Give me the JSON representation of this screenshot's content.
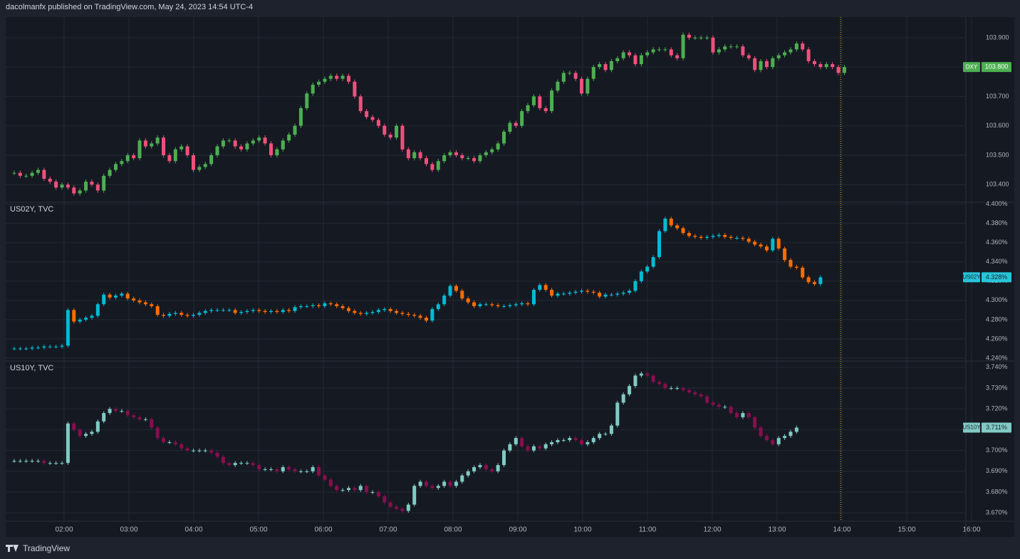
{
  "header": {
    "publisher": "dacolmanfx published on TradingView.com, May 24, 2023 14:54 UTC-4"
  },
  "footer": {
    "brand": "TradingView",
    "logo_icon": "tradingview-logo-icon"
  },
  "chart_data": [
    {
      "type": "candlestick",
      "name": "DXY",
      "title": "",
      "yticks": [
        "103.900",
        "103.800",
        "103.700",
        "103.600",
        "103.500",
        "103.400"
      ],
      "ylim": [
        103.34,
        103.97
      ],
      "last_price": "103.800",
      "price_label_color": "#4caf50",
      "up_color": "#4caf50",
      "down_color": "#f0507c",
      "closes": [
        103.44,
        103.43,
        103.43,
        103.44,
        103.45,
        103.42,
        103.41,
        103.39,
        103.4,
        103.39,
        103.37,
        103.38,
        103.41,
        103.4,
        103.38,
        103.43,
        103.45,
        103.47,
        103.48,
        103.5,
        103.49,
        103.55,
        103.53,
        103.54,
        103.56,
        103.5,
        103.48,
        103.52,
        103.53,
        103.5,
        103.45,
        103.46,
        103.47,
        103.5,
        103.53,
        103.55,
        103.55,
        103.53,
        103.52,
        103.54,
        103.55,
        103.56,
        103.54,
        103.5,
        103.52,
        103.55,
        103.57,
        103.6,
        103.66,
        103.71,
        103.74,
        103.75,
        103.76,
        103.77,
        103.76,
        103.77,
        103.75,
        103.7,
        103.65,
        103.63,
        103.62,
        103.6,
        103.57,
        103.56,
        103.6,
        103.52,
        103.49,
        103.51,
        103.49,
        103.47,
        103.45,
        103.48,
        103.5,
        103.51,
        103.5,
        103.49,
        103.49,
        103.48,
        103.5,
        103.51,
        103.52,
        103.54,
        103.58,
        103.61,
        103.6,
        103.65,
        103.67,
        103.7,
        103.66,
        103.65,
        103.72,
        103.75,
        103.78,
        103.78,
        103.76,
        103.71,
        103.76,
        103.8,
        103.81,
        103.79,
        103.82,
        103.83,
        103.85,
        103.84,
        103.81,
        103.84,
        103.85,
        103.86,
        103.86,
        103.86,
        103.84,
        103.83,
        103.91,
        103.9,
        103.9,
        103.9,
        103.9,
        103.85,
        103.86,
        103.87,
        103.87,
        103.87,
        103.84,
        103.83,
        103.79,
        103.82,
        103.8,
        103.83,
        103.84,
        103.85,
        103.86,
        103.88,
        103.86,
        103.82,
        103.81,
        103.8,
        103.81,
        103.8,
        103.78,
        103.8
      ]
    },
    {
      "type": "candlestick",
      "name": "US02Y, TVC",
      "title": "US02Y, TVC",
      "yticks": [
        "4.400%",
        "4.380%",
        "4.360%",
        "4.340%",
        "4.320%",
        "4.300%",
        "4.280%",
        "4.260%",
        "4.240%"
      ],
      "ylim": [
        4.237,
        4.402
      ],
      "last_price": "4.328%",
      "price_label_color": "#26c6da",
      "up_color": "#00bcd4",
      "down_color": "#ff6d00",
      "closes": [
        4.25,
        4.25,
        4.25,
        4.251,
        4.251,
        4.252,
        4.252,
        4.252,
        4.253,
        4.29,
        4.278,
        4.28,
        4.282,
        4.284,
        4.296,
        4.306,
        4.303,
        4.305,
        4.307,
        4.302,
        4.3,
        4.298,
        4.296,
        4.294,
        4.285,
        4.284,
        4.286,
        4.287,
        4.285,
        4.284,
        4.285,
        4.287,
        4.289,
        4.29,
        4.29,
        4.29,
        4.29,
        4.287,
        4.288,
        4.289,
        4.29,
        4.289,
        4.288,
        4.289,
        4.288,
        4.29,
        4.289,
        4.293,
        4.294,
        4.294,
        4.295,
        4.294,
        4.297,
        4.296,
        4.294,
        4.292,
        4.289,
        4.287,
        4.286,
        4.287,
        4.288,
        4.29,
        4.291,
        4.289,
        4.287,
        4.286,
        4.285,
        4.284,
        4.282,
        4.279,
        4.291,
        4.296,
        4.305,
        4.315,
        4.31,
        4.302,
        4.298,
        4.294,
        4.296,
        4.296,
        4.295,
        4.294,
        4.294,
        4.295,
        4.296,
        4.297,
        4.296,
        4.311,
        4.316,
        4.311,
        4.305,
        4.307,
        4.307,
        4.308,
        4.309,
        4.31,
        4.309,
        4.308,
        4.304,
        4.306,
        4.306,
        4.307,
        4.308,
        4.31,
        4.32,
        4.33,
        4.335,
        4.345,
        4.372,
        4.385,
        4.378,
        4.375,
        4.37,
        4.367,
        4.366,
        4.365,
        4.366,
        4.367,
        4.368,
        4.366,
        4.365,
        4.365,
        4.364,
        4.361,
        4.358,
        4.356,
        4.352,
        4.364,
        4.354,
        4.342,
        4.335,
        4.334,
        4.324,
        4.319,
        4.317,
        4.324
      ]
    },
    {
      "type": "candlestick",
      "name": "US10Y, TVC",
      "title": "US10Y, TVC",
      "yticks": [
        "3.740%",
        "3.730%",
        "3.720%",
        "3.710%",
        "3.700%",
        "3.690%",
        "3.680%",
        "3.670%"
      ],
      "ylim": [
        3.666,
        3.743
      ],
      "last_price": "3.711%",
      "price_label_color": "#80cbc4",
      "up_color": "#80cbc4",
      "down_color": "#880e4f",
      "closes": [
        3.695,
        3.695,
        3.695,
        3.695,
        3.695,
        3.694,
        3.694,
        3.694,
        3.694,
        3.713,
        3.71,
        3.707,
        3.708,
        3.709,
        3.714,
        3.718,
        3.72,
        3.719,
        3.719,
        3.717,
        3.716,
        3.715,
        3.715,
        3.711,
        3.706,
        3.704,
        3.704,
        3.703,
        3.701,
        3.7,
        3.7,
        3.7,
        3.7,
        3.699,
        3.697,
        3.694,
        3.693,
        3.694,
        3.694,
        3.694,
        3.693,
        3.691,
        3.691,
        3.691,
        3.69,
        3.692,
        3.691,
        3.69,
        3.69,
        3.69,
        3.692,
        3.688,
        3.686,
        3.683,
        3.681,
        3.681,
        3.682,
        3.681,
        3.683,
        3.68,
        3.68,
        3.678,
        3.675,
        3.673,
        3.672,
        3.671,
        3.674,
        3.683,
        3.685,
        3.683,
        3.682,
        3.683,
        3.685,
        3.683,
        3.685,
        3.688,
        3.69,
        3.692,
        3.693,
        3.691,
        3.69,
        3.693,
        3.7,
        3.703,
        3.706,
        3.702,
        3.7,
        3.702,
        3.701,
        3.703,
        3.704,
        3.705,
        3.705,
        3.706,
        3.705,
        3.703,
        3.704,
        3.706,
        3.708,
        3.708,
        3.712,
        3.723,
        3.727,
        3.731,
        3.736,
        3.737,
        3.736,
        3.733,
        3.732,
        3.73,
        3.73,
        3.73,
        3.729,
        3.728,
        3.727,
        3.726,
        3.723,
        3.722,
        3.721,
        3.721,
        3.718,
        3.716,
        3.718,
        3.716,
        3.711,
        3.707,
        3.705,
        3.703,
        3.706,
        3.707,
        3.709,
        3.711
      ]
    }
  ],
  "xaxis": {
    "labels": [
      "02:00",
      "03:00",
      "04:00",
      "05:00",
      "06:00",
      "07:00",
      "08:00",
      "09:00",
      "10:00",
      "11:00",
      "12:00",
      "13:00",
      "14:00",
      "15:00",
      "16:00"
    ]
  },
  "colors": {
    "background": "#151922",
    "grid": "#242935",
    "text": "#b2b5be",
    "crosshair": "#e6c229"
  }
}
